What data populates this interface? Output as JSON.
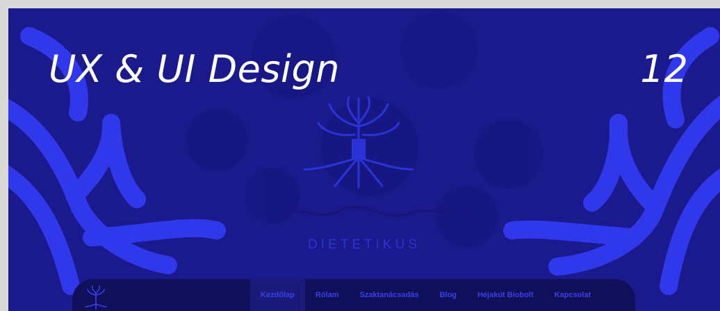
{
  "slide": {
    "title": "UX & UI Design",
    "number": "12"
  },
  "site": {
    "brand_label": "DIETETIKUS",
    "logo_icon": "tree-icon"
  },
  "nav": {
    "items": [
      {
        "label": "Kezdőlap",
        "active": true
      },
      {
        "label": "Rólam",
        "active": false
      },
      {
        "label": "Szaktanácsadás",
        "active": false
      },
      {
        "label": "Blog",
        "active": false
      },
      {
        "label": "Héjakút Biobolt",
        "active": false
      },
      {
        "label": "Kapcsolat",
        "active": false
      }
    ]
  },
  "colors": {
    "background": "#1a1a8c",
    "accent": "#3a40e8",
    "navbar": "#0f0f5a",
    "text": "#ffffff"
  }
}
